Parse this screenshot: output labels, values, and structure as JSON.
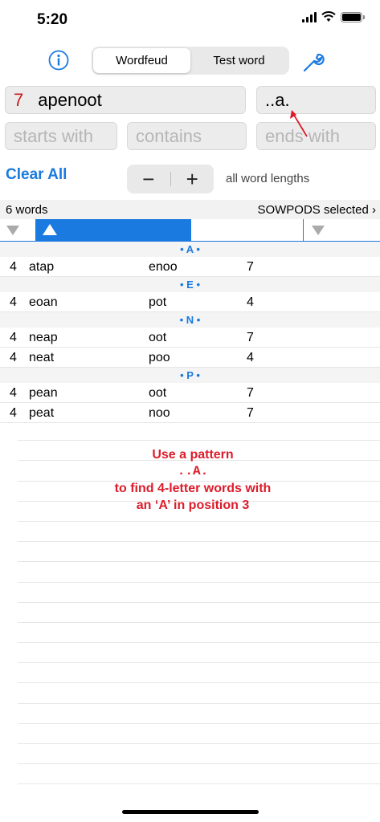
{
  "status": {
    "time": "5:20"
  },
  "toolbar": {
    "segments": [
      {
        "label": "Wordfeud",
        "active": true
      },
      {
        "label": "Test word",
        "active": false
      }
    ],
    "icons": {
      "left": "info-icon",
      "right": "wrench-icon"
    },
    "accent_color": "#1a7ae0"
  },
  "inputs": {
    "letters_count": "7",
    "letters_value": "apenoot",
    "pattern_value": "..a.",
    "starts_placeholder": "starts with",
    "contains_placeholder": "contains",
    "ends_placeholder": "ends with"
  },
  "controls": {
    "clear_all": "Clear All",
    "minus": "−",
    "plus": "+",
    "word_lengths": "all word lengths"
  },
  "summary": {
    "word_count": "6 words",
    "dictionary": "SOWPODS selected ›"
  },
  "results": [
    {
      "header": "• A •",
      "rows": [
        {
          "len": "4",
          "word": "atap",
          "remaining": "enoo",
          "count": "7"
        }
      ]
    },
    {
      "header": "• E •",
      "rows": [
        {
          "len": "4",
          "word": "eoan",
          "remaining": "pot",
          "count": "4"
        }
      ]
    },
    {
      "header": "• N •",
      "rows": [
        {
          "len": "4",
          "word": "neap",
          "remaining": "oot",
          "count": "7"
        },
        {
          "len": "4",
          "word": "neat",
          "remaining": "poo",
          "count": "4"
        }
      ]
    },
    {
      "header": "• P •",
      "rows": [
        {
          "len": "4",
          "word": "pean",
          "remaining": "oot",
          "count": "7"
        },
        {
          "len": "4",
          "word": "peat",
          "remaining": "noo",
          "count": "7"
        }
      ]
    }
  ],
  "annotation": {
    "line1": "Use a pattern",
    "line2": "..A.",
    "line3": "to find 4-letter words with",
    "line4": "an ‘A’ in position 3",
    "color": "#dd1c2a"
  }
}
